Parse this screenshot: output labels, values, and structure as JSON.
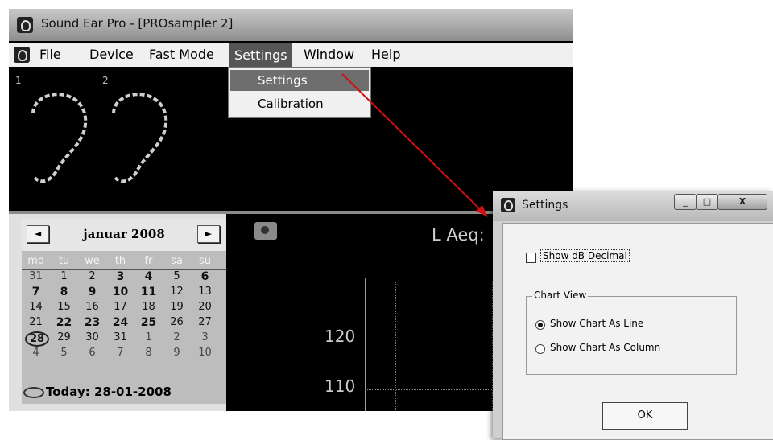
{
  "window": {
    "title": "Sound Ear Pro - [PROsampler 2]"
  },
  "menubar": {
    "items": [
      "File",
      "Device",
      "Fast Mode",
      "Settings",
      "Window",
      "Help"
    ],
    "active": "Settings"
  },
  "settings_menu": {
    "items": [
      "Settings",
      "Calibration"
    ]
  },
  "ears": {
    "labels": [
      "1",
      "2"
    ]
  },
  "calendar": {
    "month": "januar 2008",
    "prev": "◄",
    "next": "►",
    "weekdays": [
      "mo",
      "tu",
      "we",
      "th",
      "fr",
      "sa",
      "su"
    ],
    "weeks": [
      [
        "31",
        "1",
        "2",
        "3",
        "4",
        "5",
        "6"
      ],
      [
        "7",
        "8",
        "9",
        "10",
        "11",
        "12",
        "13"
      ],
      [
        "14",
        "15",
        "16",
        "17",
        "18",
        "19",
        "20"
      ],
      [
        "21",
        "22",
        "23",
        "24",
        "25",
        "26",
        "27"
      ],
      [
        "28",
        "29",
        "30",
        "31",
        "1",
        "2",
        "3"
      ],
      [
        "4",
        "5",
        "6",
        "7",
        "8",
        "9",
        "10"
      ]
    ],
    "today_label": "Today: 28-01-2008"
  },
  "chart": {
    "title": "L Aeq:",
    "y_labels": [
      "120",
      "110"
    ]
  },
  "settings_dialog": {
    "title": "Settings",
    "show_db_decimal_label": "Show dB Decimal",
    "show_db_decimal_checked": false,
    "chart_view_group": "Chart View",
    "radio_line_label": "Show Chart As Line",
    "radio_column_label": "Show Chart As Column",
    "selected_view": "line",
    "ok_label": "OK",
    "window_buttons": [
      "_",
      "□",
      "X"
    ]
  },
  "colors": {
    "arrow": "#d01010",
    "menu_highlight": "#555555",
    "calendar_bg": "#bdbdbd"
  }
}
